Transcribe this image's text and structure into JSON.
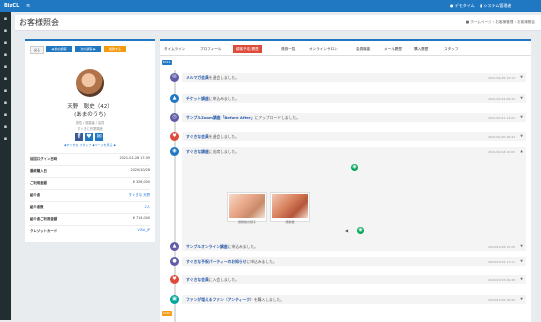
{
  "topbar": {
    "brand": "BizCL",
    "toggle": "≡",
    "user1": "● デモタイム",
    "user2": "▮ システム管理者"
  },
  "sidebar_icons": [
    "▪",
    "▪",
    "▪",
    "▪",
    "▪",
    "▪",
    "▪",
    "▪",
    "▪",
    "▪",
    "▪",
    "▪"
  ],
  "page": {
    "title": "お客様照会",
    "breadcrumb": "■ ホームページ › お客様管理 › お客様照会"
  },
  "customer": {
    "buttons": [
      "戻る",
      "◀ 前の顧客",
      "次の顧客 ▶",
      "削除する"
    ],
    "name": "天野　聡史（42）",
    "kana": "(あまのうち)",
    "meta1": "男性 / 既婚者 / 会員",
    "meta2": "すぐきに作業購読",
    "social": [
      "f",
      "♥",
      "✉"
    ],
    "info_link": "◆すぐきな スタッフ ◆ページを見る ◆",
    "fields": [
      {
        "label": "前回ログイン日時",
        "value": "2021-01-28 17:39"
      },
      {
        "label": "最終購入日",
        "value": "2020/10/28"
      },
      {
        "label": "ご利用金額",
        "value": "¥ 326,000"
      },
      {
        "label": "紹介者",
        "value": "すぐきな 天野"
      },
      {
        "label": "紹介者数",
        "value": "2人"
      },
      {
        "label": "紹介者ご利用金額",
        "value": "¥ 714,000"
      },
      {
        "label": "クレジットカード",
        "value": "VISA_JP"
      }
    ]
  },
  "tabs": [
    "タイムライン",
    "プロフィール",
    "顧客予定/履歴",
    "発券一覧",
    "オンラインサロン",
    "会員機能",
    "メール履歴",
    "購入履歴",
    "スタッフ"
  ],
  "active_tab": "顧客予定/履歴",
  "timeline": {
    "date_badge_top": "2021-01",
    "date_badge_bottom": "2020-12",
    "events": [
      {
        "icon": "✉",
        "color": "#605ca8",
        "link": "メルマガ会員",
        "text": "を退会しました。",
        "time": "2021/01/25 12:13"
      },
      {
        "icon": "▲",
        "color": "#1f78c1",
        "link": "チケット講座",
        "text": "に申込みました。",
        "time": "2021/01/22 09:32"
      },
      {
        "icon": "◷",
        "color": "#605ca8",
        "link": "サンプルZoom講座「Before After」",
        "text": "にアップロードしました。",
        "time": "2021/01/21 14:02"
      },
      {
        "icon": "♥",
        "color": "#dd4b39",
        "link": "すぐきな会員",
        "text": "を退会しました。",
        "time": "2021/01/20 18:44"
      },
      {
        "icon": "◉",
        "color": "#1f78c1",
        "link": "すぐきな講座",
        "text": "に出席しました。",
        "time": "2021/01/18 10:05"
      },
      {
        "icon": "▲",
        "color": "#605ca8",
        "link": "サンプルオンライン講座",
        "text": "に申込みました。",
        "time": "2020/12/28 15:20"
      },
      {
        "icon": "●",
        "color": "#605ca8",
        "link": "すぐきな予祝パーティーのお知らせ",
        "text": "に申込みました。",
        "time": "2020/12/21 11:11"
      },
      {
        "icon": "♥",
        "color": "#dd4b39",
        "link": "すぐきな会員",
        "text": "に入会しました。",
        "time": "2020/12/15 09:48"
      },
      {
        "icon": "▣",
        "color": "#00a69a",
        "link": "ファンが増えるファン（アンティーク）",
        "text": "を購入しました。",
        "time": "2020/12/05 16:30"
      }
    ],
    "photos": [
      {
        "caption": "施術前の様子"
      },
      {
        "caption": "施術後"
      }
    ]
  }
}
